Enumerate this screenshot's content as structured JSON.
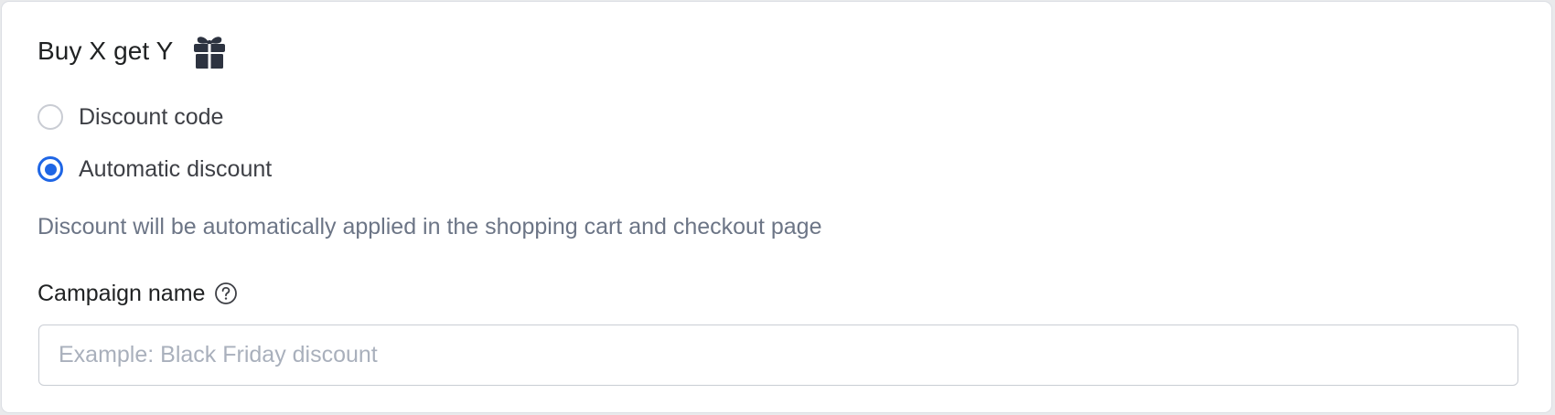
{
  "section": {
    "title": "Buy X get Y",
    "title_icon": "gift-icon"
  },
  "discount_type": {
    "options": [
      {
        "label": "Discount code",
        "checked": false
      },
      {
        "label": "Automatic discount",
        "checked": true
      }
    ],
    "help_text": "Discount will be automatically applied in the shopping cart and checkout page"
  },
  "campaign": {
    "label": "Campaign name",
    "help_icon": "question-circle-icon",
    "value": "",
    "placeholder": "Example: Black Friday discount"
  },
  "colors": {
    "accent": "#1f66e5",
    "text": "#202223",
    "muted": "#6c7586",
    "border": "#c9cdd4"
  }
}
